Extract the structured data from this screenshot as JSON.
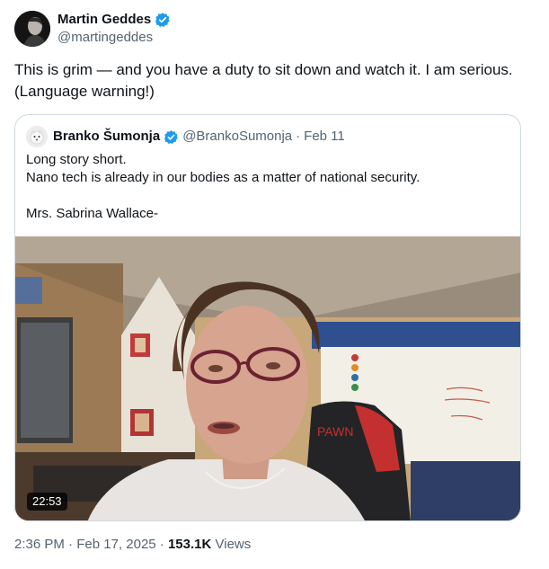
{
  "author": {
    "name": "Martin Geddes",
    "handle": "@martingeddes"
  },
  "tweet": {
    "text": "This is grim — and you have a duty to sit down and watch it. I am serious. (Language warning!)"
  },
  "quote": {
    "name": "Branko Šumonja",
    "handle": "@BrankoSumonja",
    "separator": "·",
    "date": "Feb 11",
    "lines": [
      "Long story short.",
      "Nano tech is already in our bodies as a matter of national security.",
      "",
      "Mrs. Sabrina Wallace-"
    ],
    "video": {
      "duration": "22:53",
      "chair_brand": "PAWN"
    }
  },
  "meta": {
    "time": "2:36 PM",
    "separator": "·",
    "date": "Feb 17, 2025",
    "views_count": "153.1K",
    "views_label": "Views"
  },
  "colors": {
    "verified": "#1d9bf0",
    "secondary_text": "#536471",
    "border": "#cfd9de"
  }
}
